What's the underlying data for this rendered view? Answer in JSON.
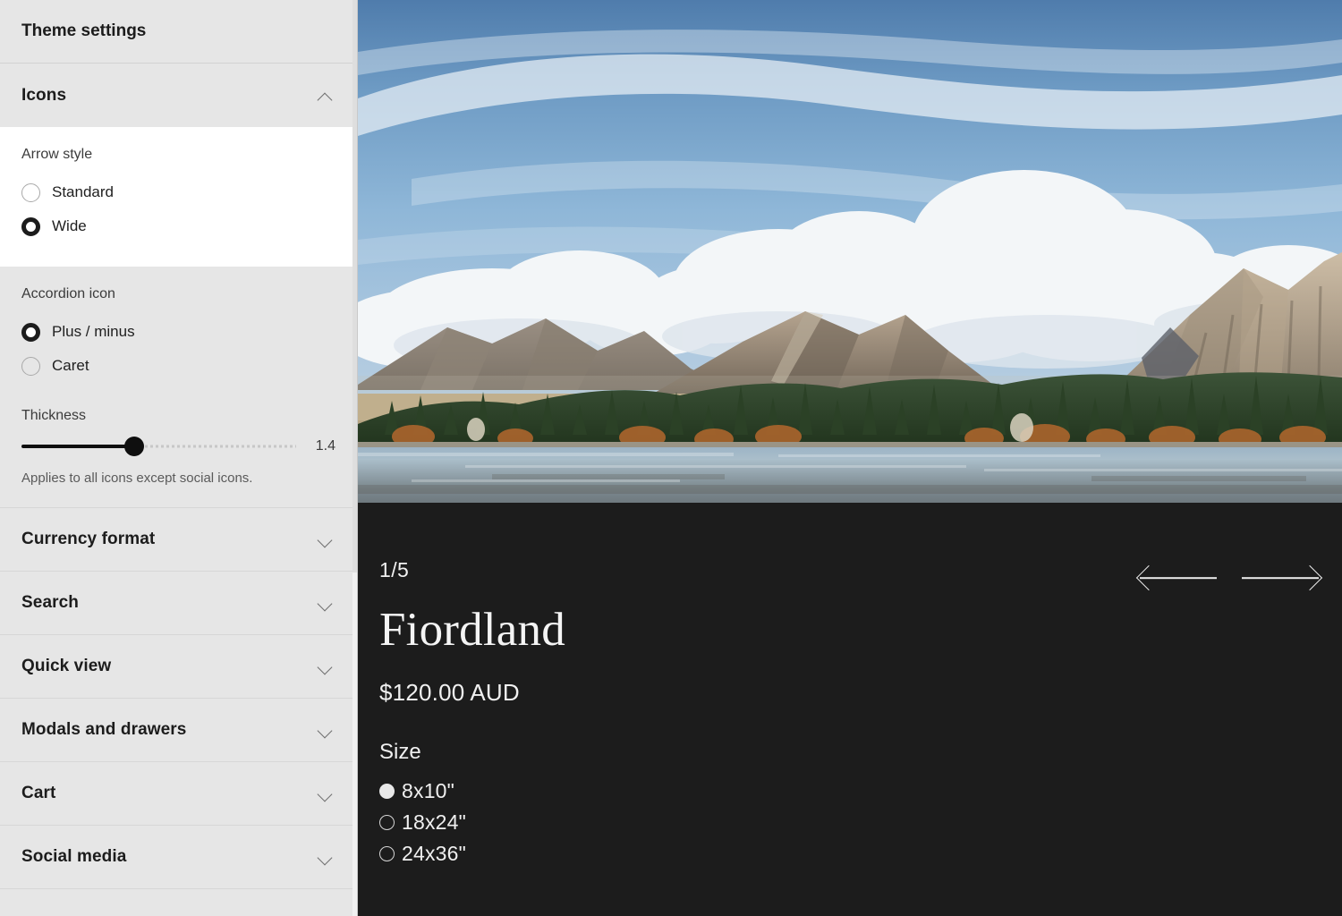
{
  "sidebar": {
    "title": "Theme settings",
    "sections": [
      {
        "label": "Icons",
        "expanded": true,
        "groups": [
          {
            "label": "Arrow style",
            "options": [
              {
                "label": "Standard",
                "selected": false
              },
              {
                "label": "Wide",
                "selected": true
              }
            ]
          },
          {
            "label": "Accordion icon",
            "options": [
              {
                "label": "Plus / minus",
                "selected": true
              },
              {
                "label": "Caret",
                "selected": false
              }
            ]
          }
        ],
        "slider": {
          "label": "Thickness",
          "value": "1.4",
          "min": 0,
          "max": 3,
          "percent": 41,
          "help": "Applies to all icons except social icons."
        }
      },
      {
        "label": "Currency format",
        "expanded": false
      },
      {
        "label": "Search",
        "expanded": false
      },
      {
        "label": "Quick view",
        "expanded": false
      },
      {
        "label": "Modals and drawers",
        "expanded": false
      },
      {
        "label": "Cart",
        "expanded": false
      },
      {
        "label": "Social media",
        "expanded": false
      }
    ]
  },
  "preview": {
    "image_alt": "Mountain lake landscape with pine forest and autumn trees",
    "counter": "1/5",
    "prev_label": "Previous",
    "next_label": "Next",
    "product": {
      "title": "Fiordland",
      "price": "$120.00 AUD",
      "option_label": "Size",
      "options": [
        {
          "label": "8x10\"",
          "selected": true
        },
        {
          "label": "18x24\"",
          "selected": false
        },
        {
          "label": "24x36\"",
          "selected": false
        }
      ]
    }
  },
  "colors": {
    "sidebar_bg": "#e6e6e6",
    "panel_bg": "#ffffff",
    "preview_bg": "#1c1c1c",
    "accent": "#0f0f0f",
    "text": "#1c1c1c"
  }
}
